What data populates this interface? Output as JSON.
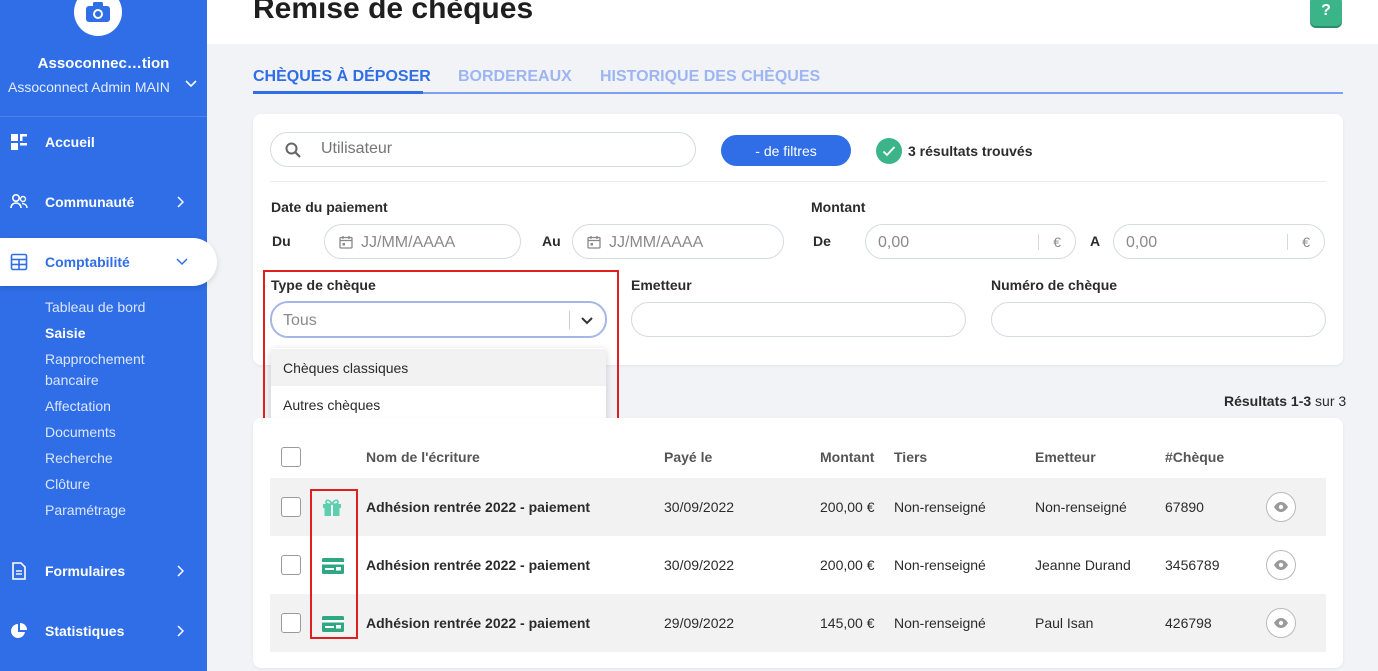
{
  "sidebar": {
    "org_name": "Assoconnec…tion",
    "org_sub": "Assoconnect Admin MAIN",
    "nav": {
      "home": "Accueil",
      "community": "Communauté",
      "accounting": "Comptabilité",
      "forms": "Formulaires",
      "stats": "Statistiques"
    },
    "sub_items": [
      "Tableau de bord",
      "Saisie",
      "Rapprochement",
      "bancaire",
      "Affectation",
      "Documents",
      "Recherche",
      "Clôture",
      "Paramétrage"
    ]
  },
  "page": {
    "title": "Remise de chèques",
    "help": "?"
  },
  "tabs": [
    "CHÈQUES À DÉPOSER",
    "BORDEREAUX",
    "HISTORIQUE DES CHÈQUES"
  ],
  "filters": {
    "search_placeholder": "Utilisateur",
    "less_filters": "- de filtres",
    "results_found": "3 résultats trouvés",
    "payment_date_label": "Date du paiement",
    "from_label": "Du",
    "to_label": "Au",
    "date_placeholder": "JJ/MM/AAAA",
    "amount_label": "Montant",
    "amount_from_label": "De",
    "amount_to_label": "A",
    "amount_value": "0,00",
    "currency": "€",
    "check_type_label": "Type de chèque",
    "check_type_value": "Tous",
    "check_type_options": [
      "Chèques classiques",
      "Autres chèques"
    ],
    "issuer_label": "Emetteur",
    "check_number_label": "Numéro de chèque"
  },
  "results": {
    "range": "Résultats 1-3",
    "total": "sur 3"
  },
  "table": {
    "headers": [
      "Nom de l'écriture",
      "Payé le",
      "Montant",
      "Tiers",
      "Emetteur",
      "#Chèque"
    ],
    "rows": [
      {
        "type_icon": "gift-icon",
        "name": "Adhésion rentrée 2022 - paiement",
        "date": "30/09/2022",
        "amount": "200,00 €",
        "third_party": "Non-renseigné",
        "issuer": "Non-renseigné",
        "number": "67890"
      },
      {
        "type_icon": "check-card-icon",
        "name": "Adhésion rentrée 2022 - paiement",
        "date": "30/09/2022",
        "amount": "200,00 €",
        "third_party": "Non-renseigné",
        "issuer": "Jeanne Durand",
        "number": "3456789"
      },
      {
        "type_icon": "check-card-icon",
        "name": "Adhésion rentrée 2022 - paiement",
        "date": "29/09/2022",
        "amount": "145,00 €",
        "third_party": "Non-renseigné",
        "issuer": "Paul Isan",
        "number": "426798"
      }
    ]
  },
  "colors": {
    "brand": "#2f6ee6",
    "success": "#3cb48a",
    "highlight": "#e02020"
  }
}
